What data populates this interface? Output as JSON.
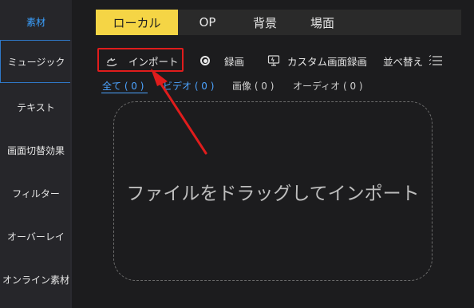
{
  "sidebar": {
    "items": [
      {
        "label": "素材"
      },
      {
        "label": "ミュージック"
      },
      {
        "label": "テキスト"
      },
      {
        "label": "画面切替効果"
      },
      {
        "label": "フィルター"
      },
      {
        "label": "オーバーレイ"
      },
      {
        "label": "オンライン素材"
      }
    ]
  },
  "tabs": [
    {
      "label": "ローカル"
    },
    {
      "label": "OP"
    },
    {
      "label": "背景"
    },
    {
      "label": "場面"
    }
  ],
  "toolbar": {
    "import_label": "インポート",
    "record_label": "録画",
    "custom_record_label": "カスタム画面録画",
    "sort_label": "並べ替え"
  },
  "filters": [
    {
      "label": "全て ( 0 )"
    },
    {
      "label": "ビデオ ( 0 )"
    },
    {
      "label": "画像 ( 0 )"
    },
    {
      "label": "オーディオ ( 0 )"
    }
  ],
  "dropzone": {
    "text": "ファイルをドラッグしてインポート"
  },
  "colors": {
    "accent_tab": "#f5d545",
    "link_blue": "#4ca3ff",
    "highlight": "#e01c1c",
    "annotation_arrow": "#e01c1c"
  },
  "icons": {
    "import": "import-icon",
    "record": "record-radio-icon",
    "custom_record": "screen-record-icon",
    "sort": "sort-lines-icon"
  }
}
